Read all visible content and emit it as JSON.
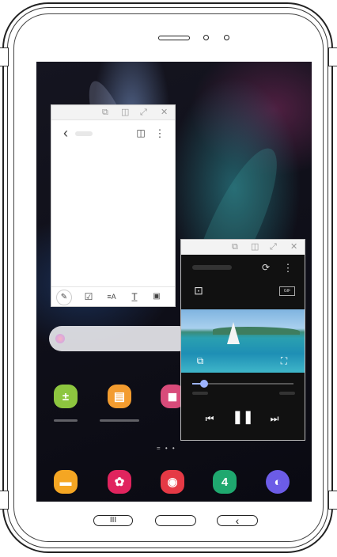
{
  "device": {
    "nav": {
      "recents_icon": "III",
      "back_icon": "‹"
    }
  },
  "notes_window": {
    "window_controls": [
      "⧉",
      "◫",
      "⤢",
      "✕"
    ],
    "back_icon": "‹",
    "reader_icon": "◫",
    "more_icon": "⋮",
    "toolbar_icons": [
      "pen-icon",
      "checkbox-icon",
      "text-style-icon",
      "text-format-icon",
      "attach-icon"
    ],
    "toolbar_glyphs": [
      "✎",
      "☑",
      "≡A",
      "T̲",
      "▣"
    ]
  },
  "video_window": {
    "window_controls": [
      "⧉",
      "◫",
      "⤢",
      "✕"
    ],
    "rotate_icon": "⟳",
    "more_icon": "⋮",
    "capture_icon": "⊡",
    "gif_label": "GIF",
    "popup_icon": "⧉",
    "fullscreen_icon": "⛶",
    "progress": 0.12,
    "prev_icon": "⏮",
    "pause_icon": "❚❚",
    "next_icon": "⏭"
  },
  "home": {
    "apps_row1": [
      {
        "name": "calculator-icon",
        "glyph": "±",
        "color": "#8dc63f"
      },
      {
        "name": "notes-icon",
        "glyph": "▤",
        "color": "#f39c2f"
      },
      {
        "name": "store-icon",
        "glyph": "◼",
        "color": "#d84b7a"
      }
    ],
    "page_indicator": "= • •",
    "dock": [
      {
        "name": "my-files-icon",
        "glyph": "▬",
        "color": "#f5a623"
      },
      {
        "name": "gallery-icon",
        "glyph": "✿",
        "color": "#e0245e"
      },
      {
        "name": "camera-icon",
        "glyph": "◉",
        "color": "#e53945"
      },
      {
        "name": "calendar-icon",
        "glyph": "4",
        "color": "#1fa86f"
      },
      {
        "name": "internet-icon",
        "glyph": "◐",
        "color": "#6c5ce7"
      }
    ]
  }
}
